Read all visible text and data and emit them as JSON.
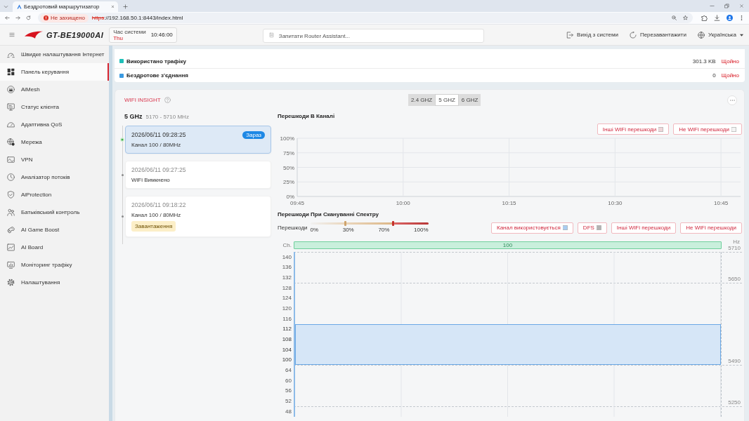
{
  "browser": {
    "tab_title": "Бездротовий маршрутизатор",
    "security_label": "Не захищено",
    "url_scheme": "https",
    "url_rest": "://192.168.50.1:8443/index.html"
  },
  "header": {
    "model": "GT-BE19000AI",
    "time_label": "Час системи",
    "day": "Thu",
    "time": "10:46:00",
    "search_placeholder": "Запитати Router Assistant...",
    "actions": [
      {
        "kind": "logout",
        "label": "Вихід з системи"
      },
      {
        "kind": "restart",
        "label": "Перезавантажити"
      },
      {
        "kind": "language",
        "label": "Українська"
      }
    ]
  },
  "sidebar": {
    "items": [
      {
        "label": "Швидке налаштування Інтернет",
        "selected": false
      },
      {
        "label": "Панель керування",
        "selected": true
      },
      {
        "label": "AiMesh",
        "selected": false
      },
      {
        "label": "Статус клієнта",
        "selected": false
      },
      {
        "label": "Адаптивна QoS",
        "selected": false
      },
      {
        "label": "Мережа",
        "selected": false
      },
      {
        "label": "VPN",
        "selected": false
      },
      {
        "label": "Аналізатор потоків",
        "selected": false
      },
      {
        "label": "AiProtection",
        "selected": false
      },
      {
        "label": "Батьківський контроль",
        "selected": false
      },
      {
        "label": "AI Game Boost",
        "selected": false
      },
      {
        "label": "AI Board",
        "selected": false
      },
      {
        "label": "Моніторинг трафіку",
        "selected": false
      },
      {
        "label": "Налаштування",
        "selected": false
      }
    ]
  },
  "traffic": [
    {
      "label": "Використано трафіку",
      "value": "301.3 KB",
      "updated": "Щойно",
      "color": "#1fbfb8"
    },
    {
      "label": "Бездротове з'єднання",
      "value": "0",
      "updated": "Щойно",
      "color": "#3b9ae1"
    }
  ],
  "wifi_insight": {
    "title": "WIFI INSIGHT",
    "bands": [
      {
        "label": "2.4 GHZ",
        "selected": false
      },
      {
        "label": "5 GHZ",
        "selected": true
      },
      {
        "label": "6 GHZ",
        "selected": false
      }
    ],
    "band_name": "5 GHz",
    "band_range": "5170 - 5710 MHz",
    "events": [
      {
        "time": "2026/06/11 09:28:25",
        "detail": "Канал 100 / 80MHz",
        "badge": "Зараз",
        "selected": true
      },
      {
        "time": "2026/06/11 09:27:25",
        "detail": "WiFi Вимкнено",
        "selected": false
      },
      {
        "time": "2026/06/11 09:18:22",
        "detail": "Канал 100 / 80MHz",
        "tag": "Завантаження",
        "selected": false
      }
    ],
    "channel_interference": {
      "title": "Перешкоди В Каналі",
      "legend": [
        {
          "label": "Інші WiFi перешкоди",
          "color": "#efd6d9"
        },
        {
          "label": "Не WiFi перешкоди",
          "color": "#f3f3f3"
        }
      ],
      "chart_data": {
        "type": "line",
        "categories": [
          "09:45",
          "10:00",
          "10:15",
          "10:30",
          "10:45"
        ],
        "ylim": [
          0,
          100
        ],
        "yticks": [
          {
            "value": 0,
            "label": "0%"
          },
          {
            "value": 25,
            "label": "25%"
          },
          {
            "value": 50,
            "label": "50%"
          },
          {
            "value": 75,
            "label": "75%"
          },
          {
            "value": 100,
            "label": "100%"
          }
        ],
        "grid": true
      }
    },
    "spectrum": {
      "title": "Перешкоди При Скануванні Спектру",
      "scale_label": "Перешкоди",
      "scale_ticks": [
        "0%",
        "30%",
        "70%",
        "100%"
      ],
      "scale_markers": [
        {
          "level": 0.3
        },
        {
          "level": 0.7
        }
      ],
      "legend": [
        {
          "label": "Канал використовується",
          "color": "#a9cdf2"
        },
        {
          "label": "DFS",
          "color": "#b3b3b3"
        },
        {
          "label": "Інші WiFi перешкоди"
        },
        {
          "label": "Не WiFi перешкоди"
        }
      ],
      "channel_axis_label": "Ch.",
      "frequency_unit": "Hz",
      "active_channel": "100",
      "rows": [
        {
          "channel": "140",
          "in_use": false,
          "frequency": "5710"
        },
        {
          "channel": "136",
          "in_use": false
        },
        {
          "channel": "132",
          "in_use": false
        },
        {
          "channel": "128",
          "in_use": false,
          "frequency": "5650"
        },
        {
          "channel": "124",
          "in_use": false
        },
        {
          "channel": "120",
          "in_use": false
        },
        {
          "channel": "116",
          "in_use": false
        },
        {
          "channel": "112",
          "in_use": true
        },
        {
          "channel": "108",
          "in_use": true
        },
        {
          "channel": "104",
          "in_use": true
        },
        {
          "channel": "100",
          "in_use": true
        },
        {
          "channel": "64",
          "in_use": false,
          "frequency": "5490"
        },
        {
          "channel": "60",
          "in_use": false
        },
        {
          "channel": "56",
          "in_use": false
        },
        {
          "channel": "52",
          "in_use": false
        },
        {
          "channel": "48",
          "in_use": false,
          "frequency": "5250"
        }
      ]
    }
  }
}
